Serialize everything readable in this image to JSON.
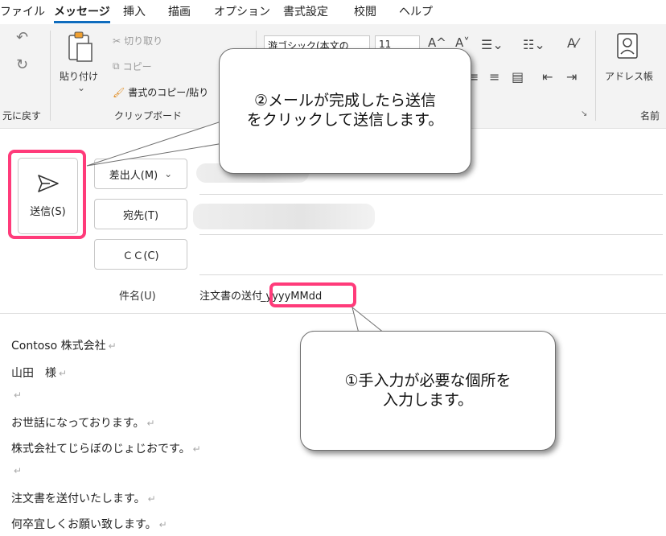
{
  "menu": {
    "items": [
      "ファイル",
      "メッセージ",
      "挿入",
      "描画",
      "オプション",
      "書式設定",
      "校閲",
      "ヘルプ"
    ],
    "active": "メッセージ"
  },
  "ribbon": {
    "undo_group_label": "元に戻す",
    "paste_label": "貼り付け",
    "cut_label": "切り取り",
    "copy_label": "コピー",
    "format_painter_label": "書式のコピー/貼り",
    "clipboard_group_label": "クリップボード",
    "font_name_partial": "游ゴシック(本文の",
    "font_size_partial": "11",
    "address_book_label": "アドレス帳",
    "names_group_label_partial": "名前"
  },
  "compose": {
    "send_label": "送信(S)",
    "from_label": "差出人(M)",
    "to_label": "宛先(T)",
    "cc_label": "ＣＣ(C)",
    "subject_label": "件名(U)",
    "subject_prefix": "注文書の送付",
    "subject_placeholder": "_yyyyMMdd"
  },
  "body_lines": [
    "Contoso 株式会社",
    "山田　様",
    "",
    "お世話になっております。",
    "株式会社てじらぼのじょじおです。",
    "",
    "注文書を送付いたします。",
    "何卒宜しくお願い致します。"
  ],
  "return_mark": "↵",
  "callouts": {
    "send_note_line1": "②メールが完成したら送信",
    "send_note_line2": "をクリックして送信します。",
    "input_note_line1": "①手入力が必要な個所を",
    "input_note_line2": "入力します。"
  },
  "colors": {
    "highlight": "#ff3b7a",
    "accent": "#0f6cbd"
  }
}
